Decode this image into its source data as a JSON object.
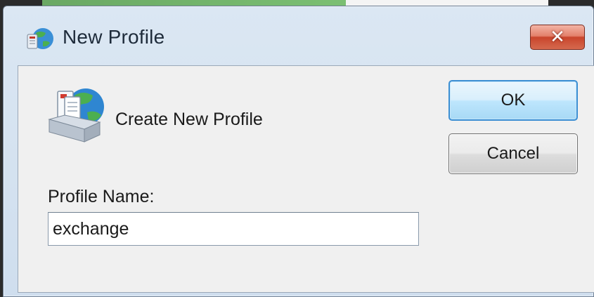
{
  "window": {
    "title": "New Profile",
    "close_glyph": "✕",
    "icon": "mail-globe-icon"
  },
  "content": {
    "icon": "profile-mailbox-icon",
    "heading": "Create New Profile",
    "profile_name_label": "Profile Name:",
    "profile_name_value": "exchange"
  },
  "buttons": {
    "ok_label": "OK",
    "cancel_label": "Cancel"
  },
  "colors": {
    "title_bar": "#cfdeee",
    "close_button": "#c9452c",
    "ok_button_border": "#3c8fd3",
    "client_background": "#f0f0f0"
  }
}
